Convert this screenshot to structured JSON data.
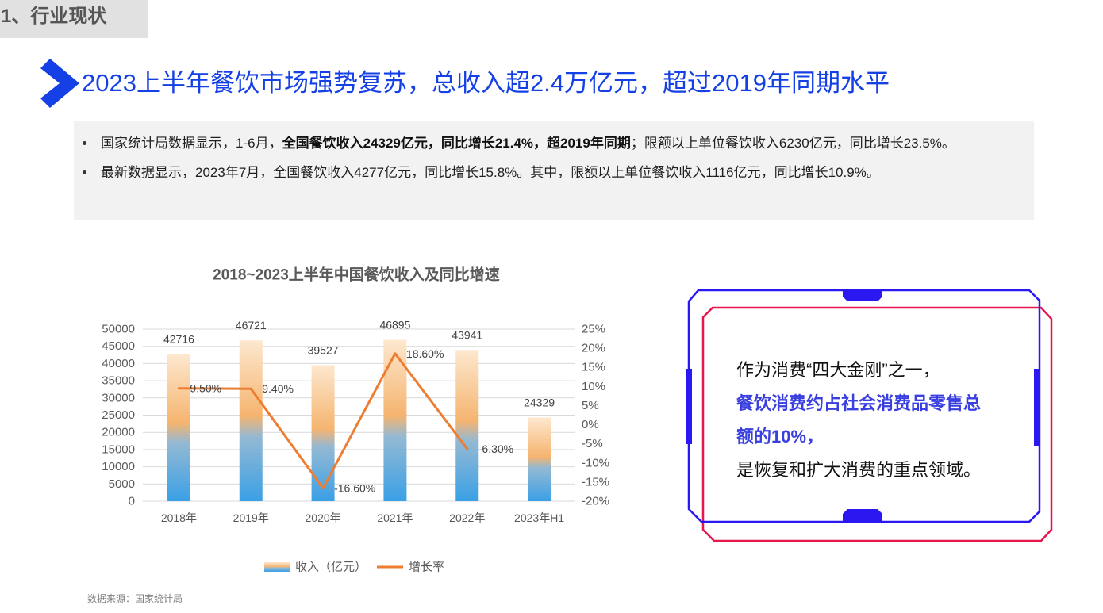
{
  "section_tab": {
    "label": "1、行业现状"
  },
  "headline": {
    "text": "2023上半年餐饮市场强势复苏，总收入超2.4万亿元，超过2019年同期水平",
    "icon": "chevron-right-icon"
  },
  "summary": {
    "bullet_1": {
      "lead": "国家统计局数据显示，1-6月，",
      "highlight": "全国餐饮收入24329亿元，同比增长21.4%，超2019年同期",
      "tail": "；限额以上单位餐饮收入6230亿元，同比增长23.5%。"
    },
    "bullet_2": {
      "text": "最新数据显示，2023年7月，全国餐饮收入4277亿元，同比增长15.8%。其中，限额以上单位餐饮收入1116亿元，同比增长10.9%。"
    }
  },
  "chart_data": {
    "type": "bar",
    "title": "2018~2023上半年中国餐饮收入及同比增速",
    "categories": [
      "2018年",
      "2019年",
      "2020年",
      "2021年",
      "2022年",
      "2023年H1"
    ],
    "series": [
      {
        "name": "收入（亿元）",
        "type": "bar",
        "axis": "left",
        "values": [
          42716,
          46721,
          39527,
          46895,
          43941,
          24329
        ]
      },
      {
        "name": "增长率",
        "type": "line",
        "axis": "right",
        "values": [
          9.5,
          9.4,
          -16.6,
          18.6,
          -6.3,
          null
        ],
        "data_labels": [
          "9.50%",
          "9.40%",
          "-16.60%",
          "18.60%",
          "-6.30%",
          null
        ]
      }
    ],
    "y_left": {
      "min": 0,
      "max": 50000,
      "step": 5000
    },
    "y_right": {
      "min": -20,
      "max": 25,
      "step": 5,
      "unit": "%"
    },
    "grid": true,
    "legend": "bottom",
    "colors": {
      "bar_gradient": [
        "#fde8cf",
        "#f5b46f",
        "#94b9d3",
        "#3aa0e6"
      ],
      "line": "#ed7d31",
      "gridline": "#d9d9d9"
    }
  },
  "source": {
    "text": "数据来源：国家统计局"
  },
  "callout": {
    "line_1": "作为消费“四大金刚”之一，",
    "highlight_line_1": "餐饮消费约占社会消费品零售总",
    "highlight_line_2": "额的10%，",
    "line_4": "是恢复和扩大消费的重点领域。"
  },
  "colors": {
    "headline_blue": "#1440e6",
    "highlight_blue": "#3a3fe0",
    "frame_blue": "#2b18f0",
    "frame_red": "#e5174c",
    "tab_gray": "#e1e1e1",
    "panel_gray": "#f2f2f2"
  }
}
